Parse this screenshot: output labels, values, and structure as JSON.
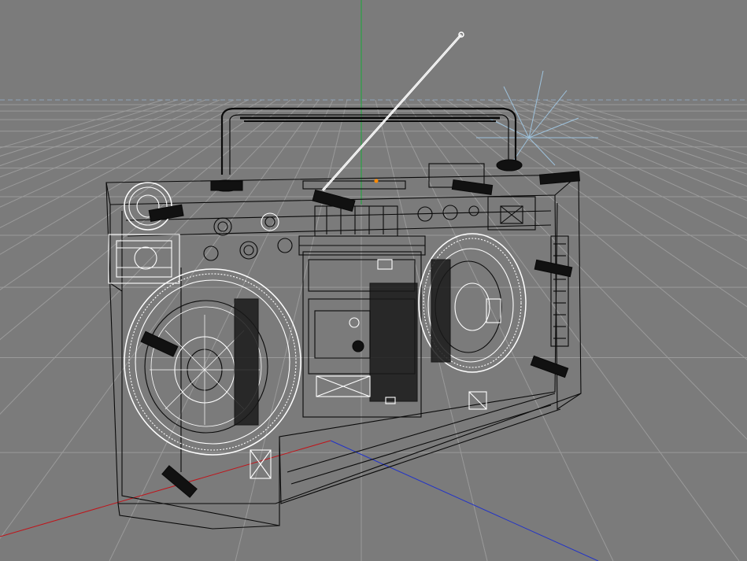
{
  "viewport": {
    "background_color": "#7b7b7b",
    "grid_color": "#9a9a9a",
    "horizon_color": "#8fa3b8"
  },
  "axes": {
    "x_axis_color": "#c0141a",
    "y_axis_color": "#17a838",
    "z_axis_color": "#2233c8"
  },
  "object": {
    "name_icon": "boombox-wireframe-icon",
    "wire_color": "#0a0a0a",
    "highlight_color": "#ffffff",
    "pivot_color": "#ff8a00"
  },
  "light": {
    "icon": "light-gizmo-icon",
    "color": "#9ec2dc"
  }
}
